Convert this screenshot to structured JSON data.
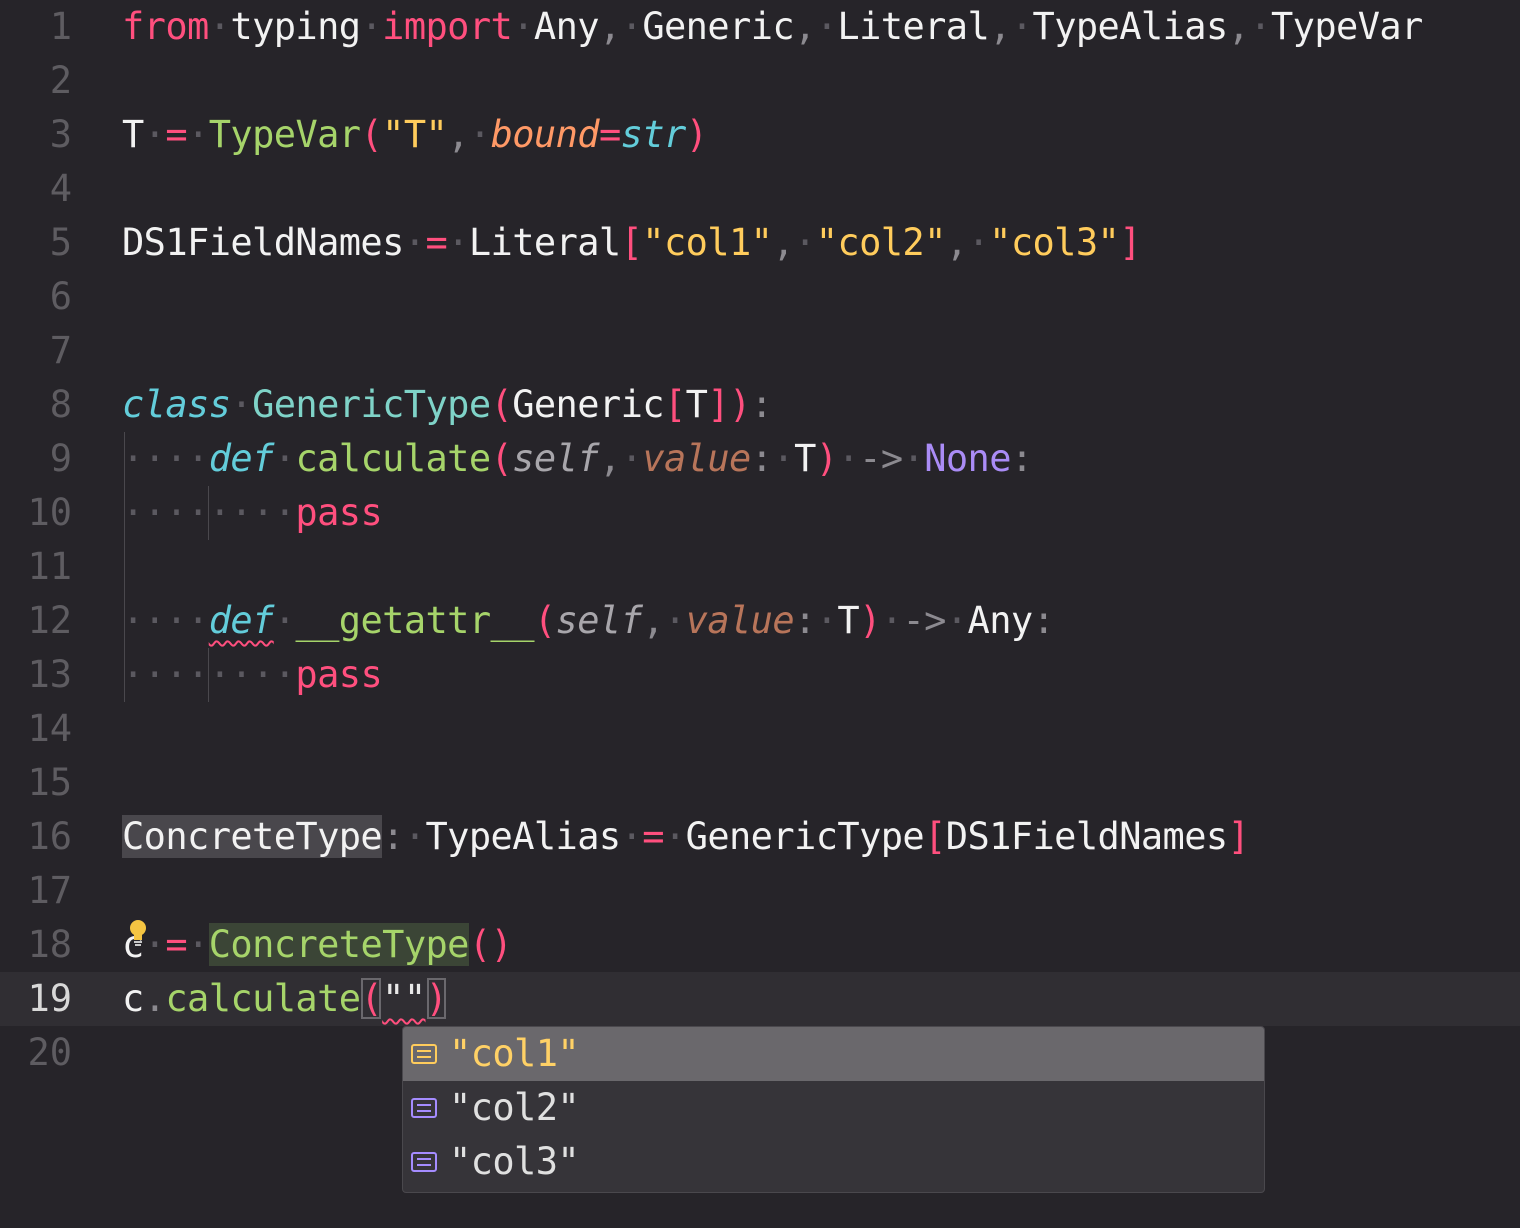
{
  "editor": {
    "line_numbers": [
      "1",
      "2",
      "3",
      "4",
      "5",
      "6",
      "7",
      "8",
      "9",
      "10",
      "11",
      "12",
      "13",
      "14",
      "15",
      "16",
      "17",
      "18",
      "19",
      "20"
    ],
    "current_line": "19",
    "line1": {
      "from": "from",
      "typing": "typing",
      "import": "import",
      "any": "Any",
      "generic": "Generic",
      "literal": "Literal",
      "typealias": "TypeAlias",
      "typevar": "TypeVar"
    },
    "line3": {
      "t": "T",
      "eq": "=",
      "typevar": "TypeVar",
      "arg": "\"T\"",
      "bound": "bound",
      "eq2": "=",
      "str": "str"
    },
    "line5": {
      "name": "DS1FieldNames",
      "eq": "=",
      "literal": "Literal",
      "col1": "\"col1\"",
      "col2": "\"col2\"",
      "col3": "\"col3\""
    },
    "line8": {
      "class": "class",
      "name": "GenericType",
      "generic": "Generic",
      "t": "T"
    },
    "line9": {
      "def": "def",
      "name": "calculate",
      "self": "self",
      "value": "value",
      "t": "T",
      "arrow": "->",
      "none": "None"
    },
    "line10": {
      "pass": "pass"
    },
    "line12": {
      "def": "def",
      "name": "__getattr__",
      "self": "self",
      "value": "value",
      "t": "T",
      "arrow": "->",
      "any": "Any"
    },
    "line13": {
      "pass": "pass"
    },
    "line16": {
      "name": "ConcreteType",
      "typealias": "TypeAlias",
      "eq": "=",
      "generic": "GenericType",
      "arg": "DS1FieldNames"
    },
    "line18": {
      "var": "c",
      "eq": "=",
      "call": "ConcreteType"
    },
    "line19": {
      "var": "c",
      "method": "calculate",
      "arg": "\"\""
    }
  },
  "suggest": {
    "items": [
      {
        "label": "\"col1\"",
        "icon": "enum-member-icon"
      },
      {
        "label": "\"col2\"",
        "icon": "enum-member-icon"
      },
      {
        "label": "\"col3\"",
        "icon": "enum-member-icon"
      }
    ]
  },
  "colors": {
    "background": "#262429",
    "keyword": "#ff4f7e",
    "function": "#a6d46a",
    "string": "#ffcc5c",
    "type": "#63cdda",
    "constant": "#aa8cf6"
  }
}
